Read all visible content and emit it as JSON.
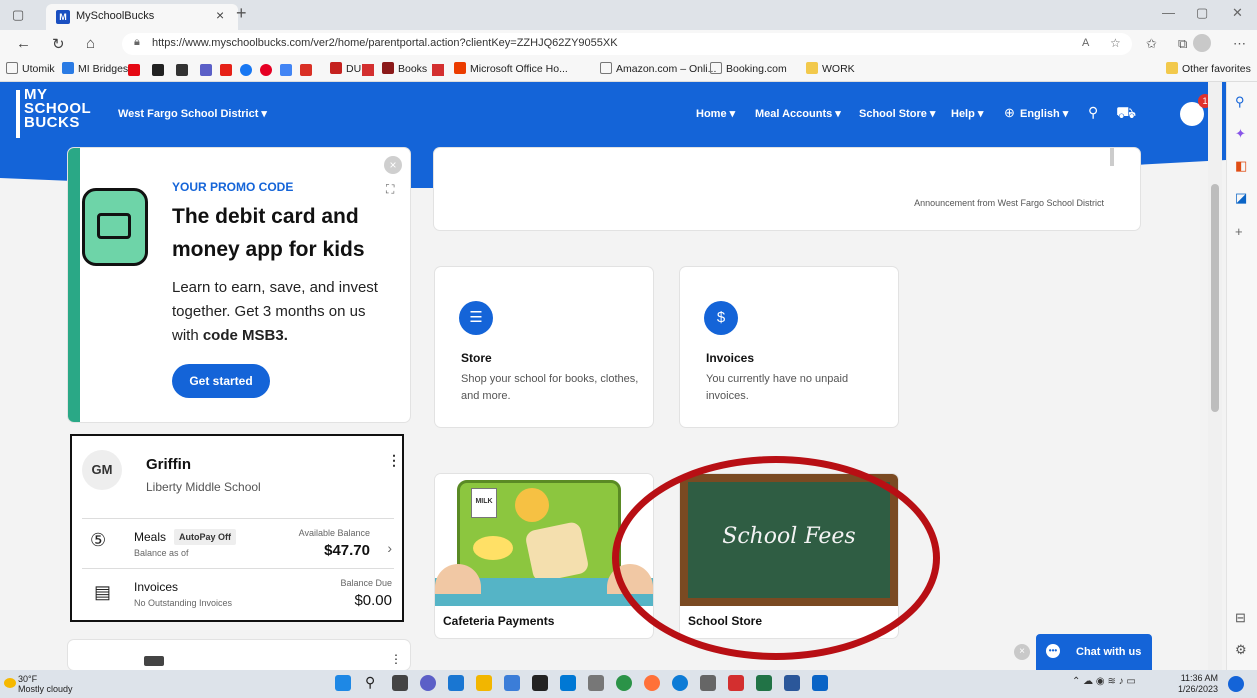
{
  "browser": {
    "tab_title": "MySchoolBucks",
    "tab_favicon": "M",
    "url": "https://www.myschoolbucks.com/ver2/home/parentportal.action?clientKey=ZZHJQ62ZY9055XK",
    "favorites": [
      "Utomik",
      "MI Bridges",
      "DU",
      "Books",
      "Microsoft Office Ho...",
      "Amazon.com – Onli...",
      "Booking.com",
      "WORK"
    ],
    "other_favorites": "Other favorites"
  },
  "header": {
    "logo_line1": "MY",
    "logo_line2": "SCHOOL",
    "logo_line3": "BUCKS",
    "district": "West Fargo School District ▾",
    "nav": [
      "Home ▾",
      "Meal Accounts ▾",
      "School Store ▾",
      "Help ▾",
      "English ▾"
    ],
    "notification_count": "1"
  },
  "promo": {
    "code_label": "YOUR PROMO CODE",
    "title": "The debit card and money app for kids",
    "body_plain": "Learn to earn, save, and invest together. Get 3 months on us with ",
    "body_code": "code MSB3.",
    "button": "Get started"
  },
  "announcement": {
    "text": "Announcement from West Fargo School District"
  },
  "tiles": [
    {
      "title": "Store",
      "desc": "Shop your school for books, clothes, and more."
    },
    {
      "title": "Invoices",
      "desc": "You currently have no unpaid invoices."
    }
  ],
  "student": {
    "initials": "GM",
    "name": "Griffin",
    "school": "Liberty Middle School",
    "meals_label": "Meals",
    "autopay": "AutoPay Off",
    "meals_sub": "Balance as of",
    "avail_label": "Available Balance",
    "avail_amount": "$47.70",
    "invoices_label": "Invoices",
    "invoices_sub": "No Outstanding Invoices",
    "due_label": "Balance Due",
    "due_amount": "$0.00"
  },
  "image_tiles": [
    {
      "caption": "Cafeteria Payments",
      "art_text": "MILK"
    },
    {
      "caption": "School Store",
      "art_text": "School Fees"
    }
  ],
  "chat": {
    "label": "Chat with us"
  },
  "taskbar": {
    "temp": "30°F",
    "weather": "Mostly cloudy",
    "time": "11:36 AM",
    "date": "1/26/2023"
  },
  "colors": {
    "brand_blue": "#1464d8",
    "highlight_red": "#b80f14",
    "promo_green": "#2aa886"
  }
}
